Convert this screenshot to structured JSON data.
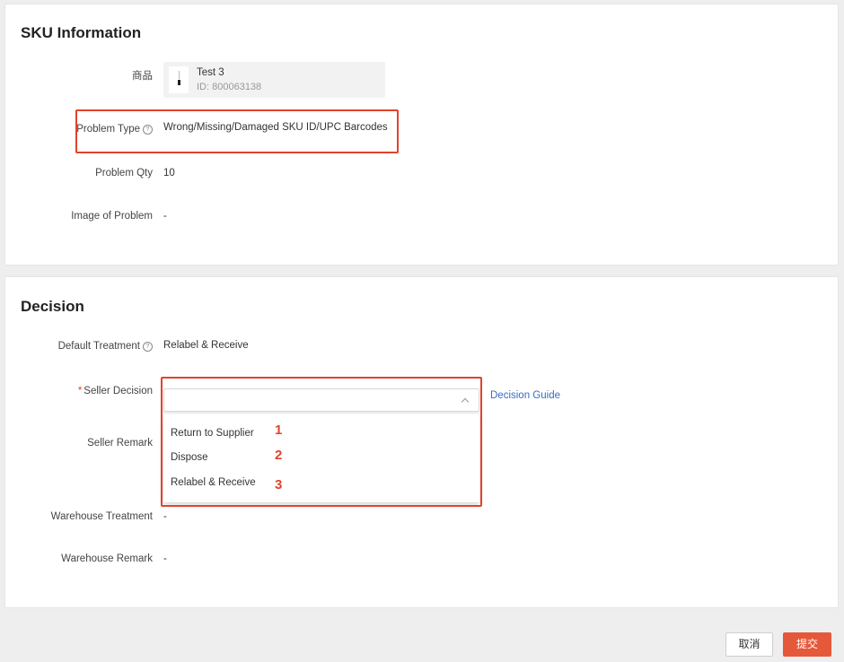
{
  "sku_section": {
    "title": "SKU Information",
    "product_label": "商品",
    "product_name": "Test 3",
    "product_id": "ID: 800063138",
    "problem_type_label": "Problem Type",
    "problem_type_value": "Wrong/Missing/Damaged SKU ID/UPC Barcodes",
    "problem_qty_label": "Problem Qty",
    "problem_qty_value": "10",
    "image_label": "Image of Problem",
    "image_value": "-"
  },
  "decision_section": {
    "title": "Decision",
    "default_treatment_label": "Default Treatment",
    "default_treatment_value": "Relabel & Receive",
    "seller_decision_label": "Seller Decision",
    "seller_decision_value": "",
    "decision_guide_link": "Decision Guide",
    "seller_remark_label": "Seller Remark",
    "dropdown_options": [
      {
        "label": "Return to Supplier",
        "step": "1"
      },
      {
        "label": "Dispose",
        "step": "2"
      },
      {
        "label": "Relabel & Receive",
        "step": "3"
      }
    ],
    "warehouse_treatment_label": "Warehouse Treatment",
    "warehouse_treatment_value": "-",
    "warehouse_remark_label": "Warehouse Remark",
    "warehouse_remark_value": "-"
  },
  "footer": {
    "cancel_label": "取消",
    "submit_label": "提交"
  },
  "colors": {
    "highlight": "#e1432a",
    "submit_button": "#e5583a",
    "link": "#3a6bc4"
  },
  "icons": {
    "help": "question-circle-icon",
    "dropdown": "chevron-up-icon"
  }
}
